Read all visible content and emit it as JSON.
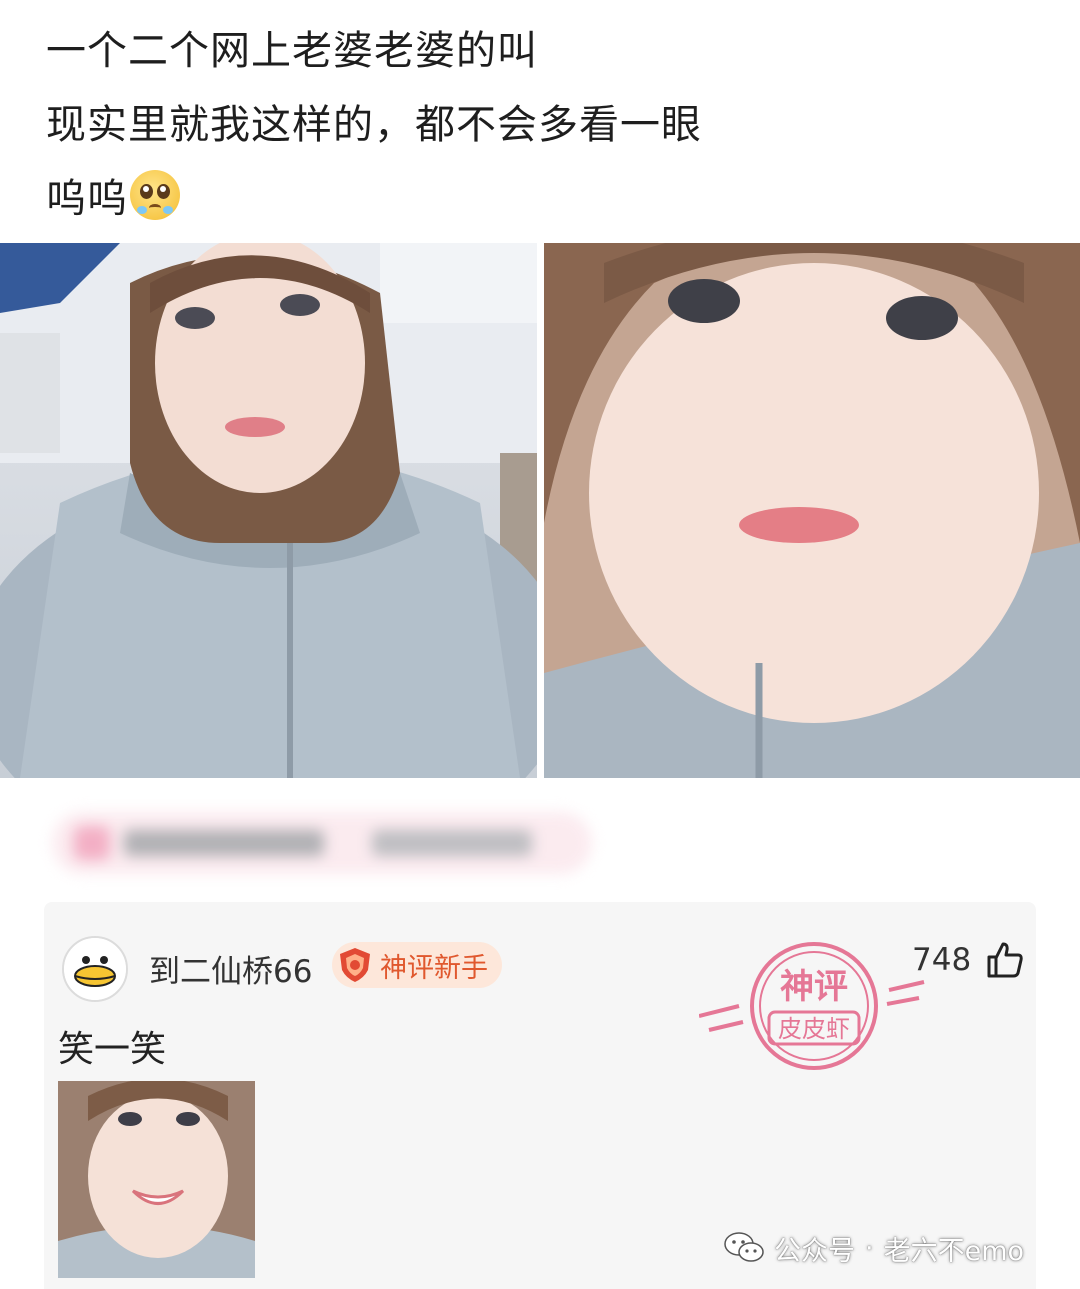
{
  "post": {
    "lines": [
      "一个二个网上老婆老婆的叫",
      "现实里就我这样的，都不会多看一眼",
      "呜呜"
    ],
    "emoji": "pleading-face-emoji"
  },
  "comment": {
    "username": "到二仙桥66",
    "badge": "神评新手",
    "text": "笑一笑",
    "likes": "748",
    "stamp_top": "神评",
    "stamp_bottom": "皮皮虾"
  },
  "watermark": {
    "prefix": "公众号",
    "separator": "·",
    "name": "老六不emo"
  },
  "colors": {
    "badge_text": "#e0582e",
    "badge_bg": "#fde7da",
    "stamp": "#e46a8c"
  }
}
